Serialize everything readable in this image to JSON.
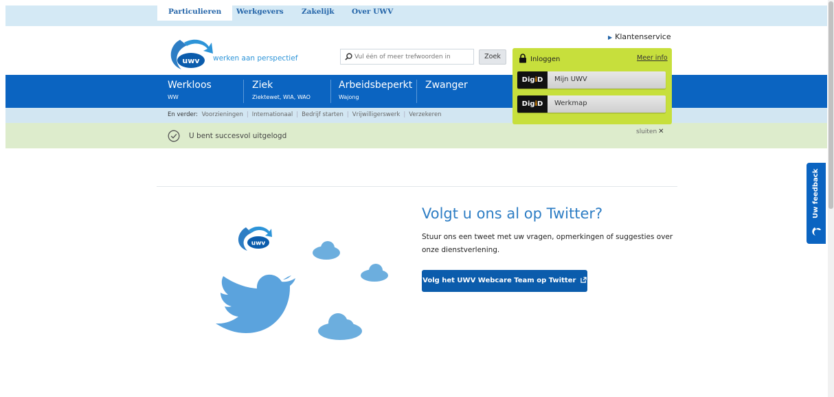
{
  "tabs": [
    {
      "label": "Particulieren",
      "active": true
    },
    {
      "label": "Werkgevers",
      "active": false
    },
    {
      "label": "Zakelijk",
      "active": false
    },
    {
      "label": "Over UWV",
      "active": false
    }
  ],
  "header": {
    "klantenservice": "Klantenservice",
    "logo_text": "uwv",
    "tagline": "werken aan perspectief",
    "search_placeholder": "Vul één of meer trefwoorden in",
    "search_button": "Zoek"
  },
  "main_nav": [
    {
      "title": "Werkloos",
      "sub": "WW"
    },
    {
      "title": "Ziek",
      "sub": "Ziektewet, WIA, WAO"
    },
    {
      "title": "Arbeidsbeperkt",
      "sub": "Wajong"
    },
    {
      "title": "Zwanger",
      "sub": ""
    }
  ],
  "sub_nav": {
    "lead": "En verder:",
    "links": [
      "Voorzieningen",
      "Internationaal",
      "Bedrijf starten",
      "Vrijwilligerswerk",
      "Verzekeren"
    ]
  },
  "notice": {
    "message": "U bent succesvol uitgelogd",
    "close_label": "sluiten",
    "close_glyph": "✕"
  },
  "login": {
    "title": "Inloggen",
    "meer_info": "Meer info",
    "digid_prefix": "Dig",
    "digid_i": "i",
    "digid_suffix": "D",
    "buttons": [
      "Mijn UWV",
      "Werkmap"
    ]
  },
  "twitter": {
    "heading": "Volgt u ons al op Twitter?",
    "body": "Stuur ons een tweet met uw vragen, opmerkingen of suggesties over onze dienstverlening.",
    "button": "Volg het UWV Webcare Team op Twitter",
    "button_icon": "external-link-icon",
    "logo_text": "uwv"
  },
  "feedback": {
    "label": "Uw feedback"
  },
  "colors": {
    "brand_blue": "#0b64c1",
    "login_green": "#c7df3c",
    "success_green": "#ddeccc",
    "twitter_blue": "#6caede"
  }
}
